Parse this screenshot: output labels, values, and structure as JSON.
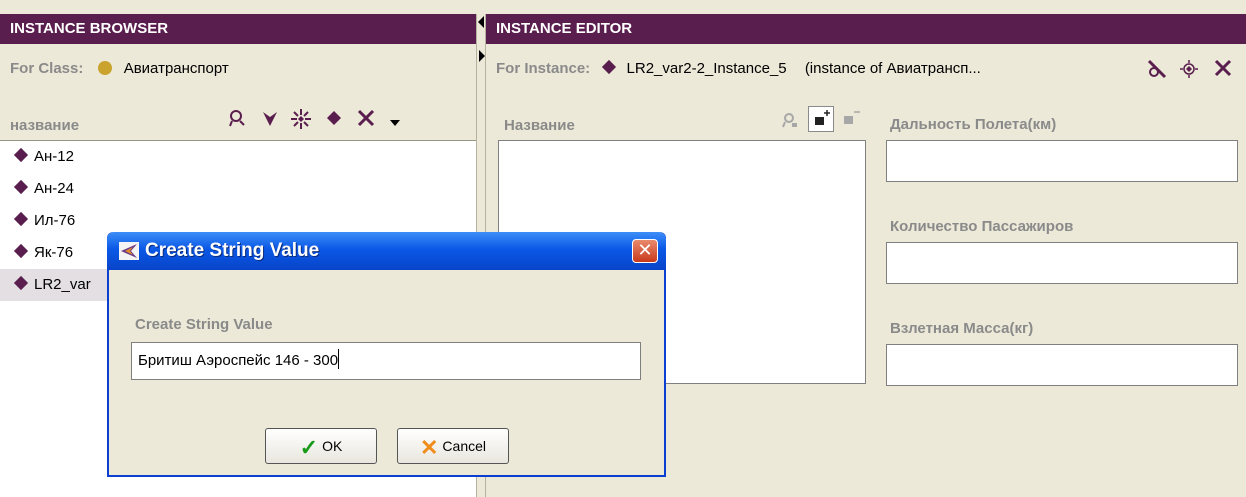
{
  "instance_browser": {
    "title": "INSTANCE BROWSER",
    "for_class_label": "For Class:",
    "class_name": "Авиатранспорт",
    "column_header": "название",
    "toolbar_icons": [
      "find-icon",
      "create-instance-icon",
      "multi-select-icon",
      "diamond-icon",
      "delete-icon",
      "dropdown-icon"
    ],
    "items": [
      {
        "label": "Ан-12",
        "selected": false
      },
      {
        "label": "Ан-24",
        "selected": false
      },
      {
        "label": "Ил-76",
        "selected": false
      },
      {
        "label": "Як-76",
        "selected": false
      },
      {
        "label": "LR2_var",
        "selected": true
      }
    ]
  },
  "instance_editor": {
    "title": "INSTANCE EDITOR",
    "for_instance_label": "For Instance:",
    "instance_name": "LR2_var2-2_Instance_5",
    "instance_of": "(instance of Авиатрансп...",
    "name_column_header": "Название",
    "fields": [
      {
        "label": "Дальность Полета(км)",
        "value": ""
      },
      {
        "label": "Количество Пассажиров",
        "value": ""
      },
      {
        "label": "Взлетная Масса(кг)",
        "value": ""
      }
    ]
  },
  "dialog": {
    "title": "Create String Value",
    "label": "Create String Value",
    "input_value": "Бритиш Аэроспейс 146 - 300",
    "ok_label": "OK",
    "cancel_label": "Cancel"
  },
  "colors": {
    "header_bg": "#5a1e4e",
    "class_dot": "#c9a32d",
    "dialog_title_bg": "#0a58e6"
  }
}
